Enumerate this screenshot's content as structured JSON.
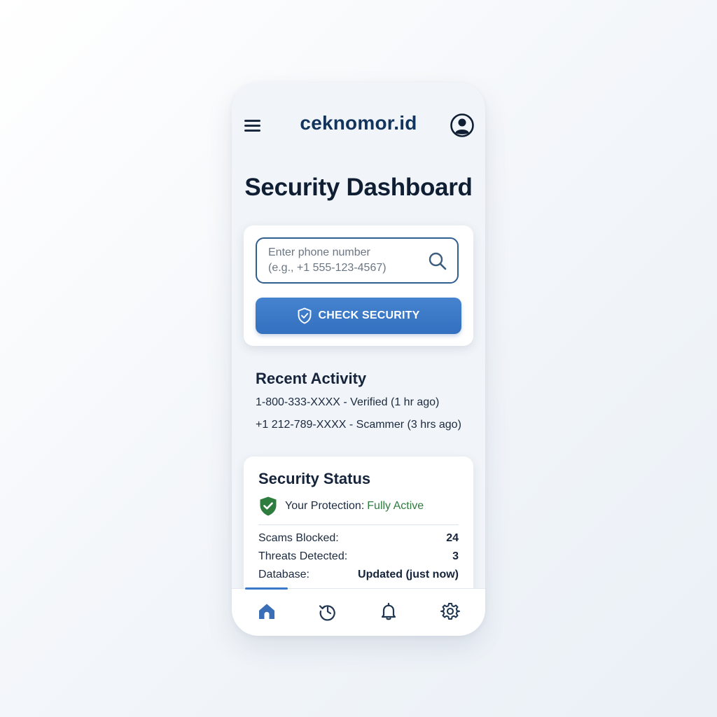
{
  "app": {
    "brand": "ceknomor.id",
    "title": "Security Dashboard"
  },
  "search": {
    "placeholder": "Enter phone number\n(e.g., +1 555-123-4567)",
    "value": "",
    "button_label": "CHECK SECURITY"
  },
  "recent": {
    "title": "Recent Activity",
    "items": [
      "1-800-333-XXXX - Verified (1 hr ago)",
      "+1 212-789-XXXX - Scammer (3 hrs ago)"
    ]
  },
  "status": {
    "title": "Security Status",
    "protection_label": "Your Protection:",
    "protection_value": "Fully Active",
    "stats": [
      {
        "label": "Scams Blocked:",
        "value": "24"
      },
      {
        "label": "Threats Detected:",
        "value": "3"
      },
      {
        "label": "Database:",
        "value": "Updated (just now)"
      }
    ]
  },
  "nav": {
    "active": "home",
    "items": [
      {
        "icon": "home-icon"
      },
      {
        "icon": "history-icon"
      },
      {
        "icon": "bell-icon"
      },
      {
        "icon": "gear-icon"
      }
    ]
  },
  "colors": {
    "brand": "#12345c",
    "accent": "#3a78c8",
    "success": "#2e7d3e",
    "nav_active": "#3a6fb8",
    "nav_inactive": "#1f3550"
  },
  "icons": {
    "menu": "menu-icon",
    "profile": "profile-icon",
    "search": "search-icon",
    "button": "shield-check-icon",
    "protection": "shield-check-icon"
  }
}
